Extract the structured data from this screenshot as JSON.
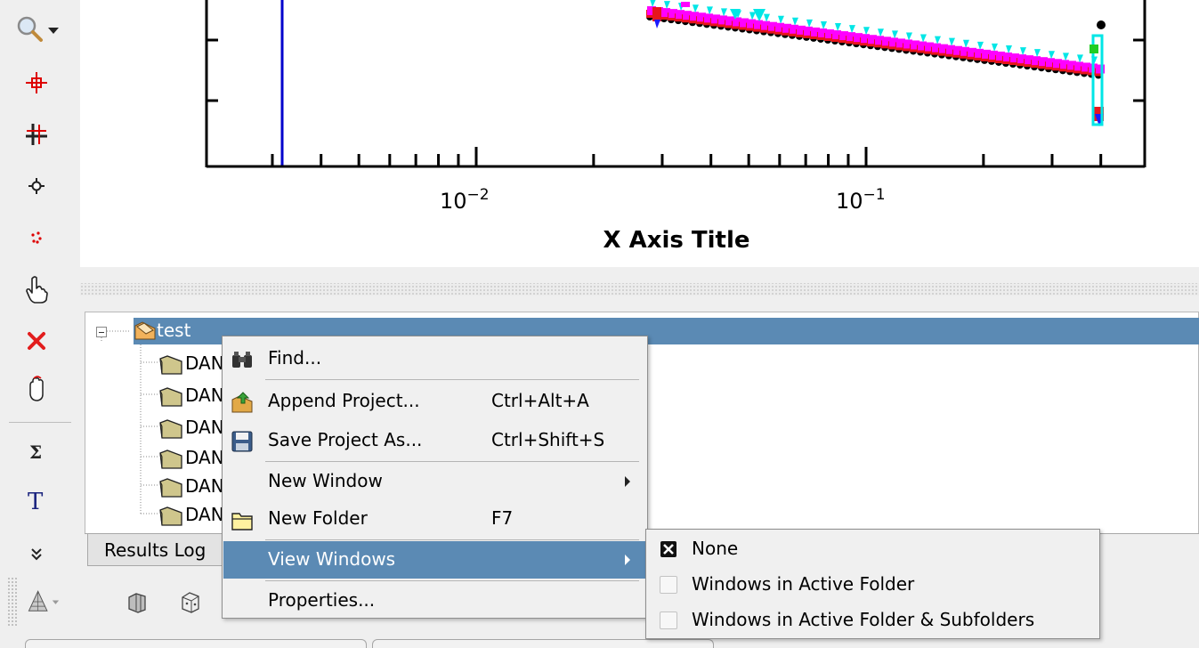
{
  "plot": {
    "x_axis_title": "X Axis Title",
    "tick_label_1": "10",
    "tick_label_1_exp": "−2",
    "tick_label_2": "10",
    "tick_label_2_exp": "−1"
  },
  "chart_data": {
    "type": "scatter",
    "xlabel": "X Axis Title",
    "x_scale": "log",
    "x_tick_labels": [
      "10−2",
      "10−1"
    ],
    "series_colors": [
      "#000000",
      "#e8151b",
      "#1a1aff",
      "#00e6e6",
      "#ff00ff",
      "#22cc22"
    ],
    "vertical_line_color": "#0000cc"
  },
  "tree": {
    "root_label": "test",
    "children": [
      "DAN",
      "DAN",
      "DAN",
      "DAN",
      "DAN",
      "DAN"
    ]
  },
  "tabs": {
    "results_log": "Results Log"
  },
  "context_menu": {
    "find": {
      "label": "Find...",
      "icon": "binoculars-icon"
    },
    "append_project": {
      "label": "Append Project...",
      "shortcut": "Ctrl+Alt+A",
      "icon": "append-project-icon"
    },
    "save_project_as": {
      "label": "Save Project As...",
      "shortcut": "Ctrl+Shift+S",
      "icon": "floppy-disk-icon"
    },
    "new_window": {
      "label": "New Window"
    },
    "new_folder": {
      "label": "New Folder",
      "shortcut": "F7",
      "icon": "new-folder-icon"
    },
    "view_windows": {
      "label": "View Windows"
    },
    "properties": {
      "label": "Properties..."
    }
  },
  "submenu": {
    "none": {
      "label": "None",
      "checked": true
    },
    "active_folder": {
      "label": "Windows in Active Folder",
      "checked": false
    },
    "active_folder_subfolders": {
      "label": "Windows in Active Folder & Subfolders",
      "checked": false
    }
  },
  "colors": {
    "selection": "#5b8ab4",
    "menu_bg": "#f0f0f0"
  }
}
